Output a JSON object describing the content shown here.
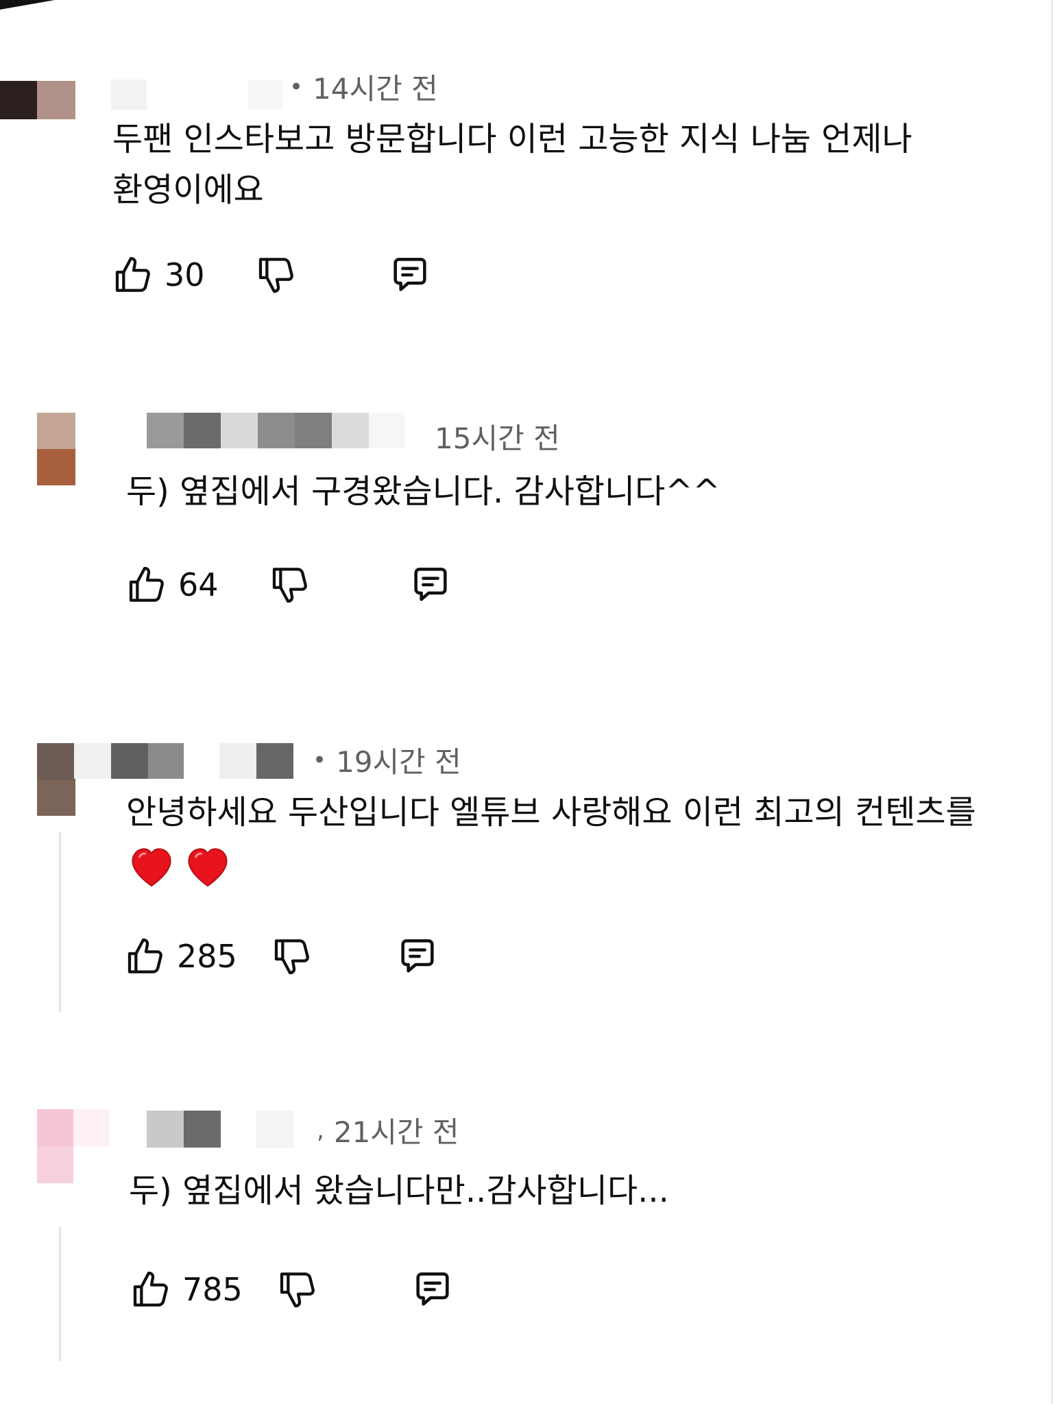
{
  "comments": [
    {
      "time": "14시간 전",
      "text": "두팬 인스타보고 방문합니다 이런 고능한 지식 나눔 언제나 환영이에요",
      "likes": "30",
      "hearts": 0,
      "redacted_avatar_colors": [
        "#2a1f1d",
        "#b1928a"
      ],
      "redacted_name_colors": [
        "#f2f2f2",
        "#ffffff",
        "#f5f5f5"
      ]
    },
    {
      "time": "15시간 전",
      "text": "두) 옆집에서 구경왔습니다. 감사합니다^^",
      "likes": "64",
      "hearts": 0,
      "redacted_avatar_colors": [
        "#c4a596",
        "#a8603c"
      ],
      "redacted_name_colors": [
        "#9a9a9a",
        "#6b6b6b",
        "#d9d9d9",
        "#8d8d8d",
        "#7f7f7f",
        "#dcdcdc",
        "#f6f6f6"
      ]
    },
    {
      "time": "19시간 전",
      "text": "안녕하세요 두산입니다 엘튜브 사랑해요 이런 최고의 컨텐츠를",
      "likes": "285",
      "hearts": 2,
      "redacted_avatar_colors": [
        "#6e5d55",
        "#7a6558"
      ],
      "redacted_name_colors": [
        "#f0f0f0",
        "#606060",
        "#8a8a8a",
        "#ffffff",
        "#efefef",
        "#666666"
      ]
    },
    {
      "time": "21시간 전",
      "text": "두) 옆집에서 왔습니다만..감사합니다...",
      "likes": "785",
      "hearts": 0,
      "redacted_avatar_colors": [
        "#f5c6d5",
        "#f7d0de"
      ],
      "redacted_name_colors": [
        "#c9c9c9",
        "#6a6a6a",
        "#ffffff",
        "#f4f4f4"
      ]
    }
  ]
}
